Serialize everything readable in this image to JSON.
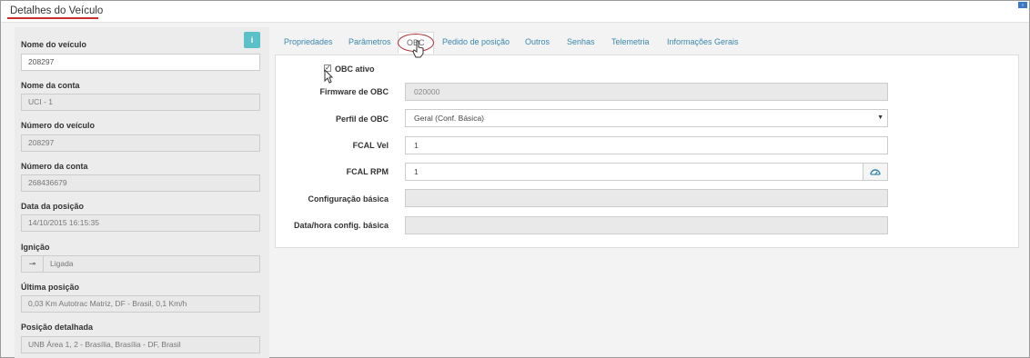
{
  "header": {
    "title": "Detalhes do Veículo"
  },
  "left": {
    "fields": [
      {
        "label": "Nome do veículo",
        "value": "208297"
      },
      {
        "label": "Nome da conta",
        "value": "UCI - 1"
      },
      {
        "label": "Número do veículo",
        "value": "208297"
      },
      {
        "label": "Número da conta",
        "value": "268436679"
      },
      {
        "label": "Data da posição",
        "value": "14/10/2015 16:15:35"
      },
      {
        "label": "Ignição",
        "value": "Ligada"
      },
      {
        "label": "Última posição",
        "value": "0,03 Km Autotrac Matriz, DF - Brasil, 0,1 Km/h"
      },
      {
        "label": "Posição detalhada",
        "value": "UNB Área 1, 2 - Brasília, Brasília - DF, Brasil"
      }
    ],
    "info_button": "i"
  },
  "tabs": [
    "Propriedades",
    "Parâmetros",
    "OBC",
    "Pedido de posição",
    "Outros",
    "Senhas",
    "Telemetria",
    "Informações Gerais"
  ],
  "active_tab": "OBC",
  "obc": {
    "active_label": "OBC ativo",
    "active_checked": true,
    "rows": [
      {
        "label": "Firmware de OBC",
        "value": "020000"
      },
      {
        "label": "Perfil de OBC",
        "value": "Geral (Conf. Básica)"
      },
      {
        "label": "FCAL Vel",
        "value": "1"
      },
      {
        "label": "FCAL RPM",
        "value": "1"
      },
      {
        "label": "Configuração básica",
        "value": ""
      },
      {
        "label": "Data/hora config. básica",
        "value": ""
      }
    ]
  },
  "colors": {
    "accent": "#3a87ad",
    "highlight": "#c9302c",
    "info_button": "#5bc0c7"
  }
}
